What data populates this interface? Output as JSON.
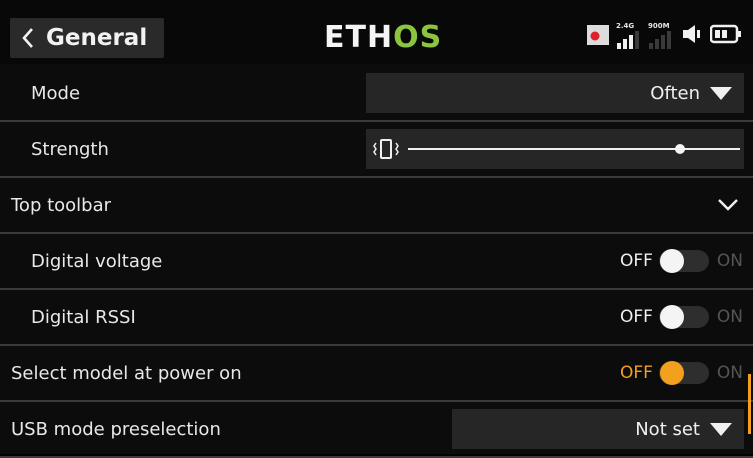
{
  "header": {
    "title": "General",
    "logo_part1": "ETH",
    "logo_part2": "OS",
    "status": {
      "signal1_label": "2.4G",
      "signal2_label": "900M"
    }
  },
  "rows": {
    "mode": {
      "label": "Mode",
      "value": "Often"
    },
    "strength": {
      "label": "Strength",
      "level": 0.82
    },
    "top_toolbar": {
      "label": "Top toolbar"
    },
    "digital_voltage": {
      "label": "Digital voltage",
      "off": "OFF",
      "on": "ON"
    },
    "digital_rssi": {
      "label": "Digital RSSI",
      "off": "OFF",
      "on": "ON"
    },
    "select_model": {
      "label": "Select model at power on",
      "off": "OFF",
      "on": "ON"
    },
    "usb_mode": {
      "label": "USB mode preselection",
      "value": "Not set"
    }
  },
  "colors": {
    "accent": "#f3a01d",
    "logo_green": "#8bc53f"
  }
}
